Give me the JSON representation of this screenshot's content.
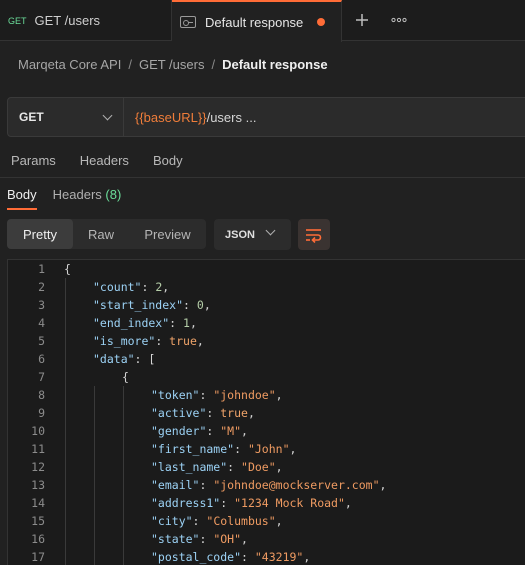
{
  "tabs": [
    {
      "method": "GET",
      "title": "GET /users"
    },
    {
      "title": "Default response"
    }
  ],
  "breadcrumb": {
    "collection": "Marqeta Core API",
    "request": "GET /users",
    "current": "Default response"
  },
  "urlbar": {
    "method": "GET",
    "variable": "{{baseURL}}",
    "path": "/users ..."
  },
  "request_tabs": [
    "Params",
    "Headers",
    "Body"
  ],
  "response_tabs": {
    "body": "Body",
    "headers": "Headers",
    "headers_count": "(8)"
  },
  "view_modes": [
    "Pretty",
    "Raw",
    "Preview"
  ],
  "format": "JSON",
  "code_lines": [
    {
      "n": "1",
      "ind": 0,
      "parts": [
        {
          "t": "{",
          "c": "p"
        }
      ]
    },
    {
      "n": "2",
      "ind": 1,
      "parts": [
        {
          "t": "\"count\"",
          "c": "k"
        },
        {
          "t": ": ",
          "c": "p"
        },
        {
          "t": "2",
          "c": "n"
        },
        {
          "t": ",",
          "c": "p"
        }
      ]
    },
    {
      "n": "3",
      "ind": 1,
      "parts": [
        {
          "t": "\"start_index\"",
          "c": "k"
        },
        {
          "t": ": ",
          "c": "p"
        },
        {
          "t": "0",
          "c": "n"
        },
        {
          "t": ",",
          "c": "p"
        }
      ]
    },
    {
      "n": "4",
      "ind": 1,
      "parts": [
        {
          "t": "\"end_index\"",
          "c": "k"
        },
        {
          "t": ": ",
          "c": "p"
        },
        {
          "t": "1",
          "c": "n"
        },
        {
          "t": ",",
          "c": "p"
        }
      ]
    },
    {
      "n": "5",
      "ind": 1,
      "parts": [
        {
          "t": "\"is_more\"",
          "c": "k"
        },
        {
          "t": ": ",
          "c": "p"
        },
        {
          "t": "true",
          "c": "b"
        },
        {
          "t": ",",
          "c": "p"
        }
      ]
    },
    {
      "n": "6",
      "ind": 1,
      "parts": [
        {
          "t": "\"data\"",
          "c": "k"
        },
        {
          "t": ": [",
          "c": "p"
        }
      ]
    },
    {
      "n": "7",
      "ind": 2,
      "parts": [
        {
          "t": "{",
          "c": "p"
        }
      ]
    },
    {
      "n": "8",
      "ind": 3,
      "parts": [
        {
          "t": "\"token\"",
          "c": "k"
        },
        {
          "t": ": ",
          "c": "p"
        },
        {
          "t": "\"johndoe\"",
          "c": "s"
        },
        {
          "t": ",",
          "c": "p"
        }
      ]
    },
    {
      "n": "9",
      "ind": 3,
      "parts": [
        {
          "t": "\"active\"",
          "c": "k"
        },
        {
          "t": ": ",
          "c": "p"
        },
        {
          "t": "true",
          "c": "b"
        },
        {
          "t": ",",
          "c": "p"
        }
      ]
    },
    {
      "n": "10",
      "ind": 3,
      "parts": [
        {
          "t": "\"gender\"",
          "c": "k"
        },
        {
          "t": ": ",
          "c": "p"
        },
        {
          "t": "\"M\"",
          "c": "s"
        },
        {
          "t": ",",
          "c": "p"
        }
      ]
    },
    {
      "n": "11",
      "ind": 3,
      "parts": [
        {
          "t": "\"first_name\"",
          "c": "k"
        },
        {
          "t": ": ",
          "c": "p"
        },
        {
          "t": "\"John\"",
          "c": "s"
        },
        {
          "t": ",",
          "c": "p"
        }
      ]
    },
    {
      "n": "12",
      "ind": 3,
      "parts": [
        {
          "t": "\"last_name\"",
          "c": "k"
        },
        {
          "t": ": ",
          "c": "p"
        },
        {
          "t": "\"Doe\"",
          "c": "s"
        },
        {
          "t": ",",
          "c": "p"
        }
      ]
    },
    {
      "n": "13",
      "ind": 3,
      "parts": [
        {
          "t": "\"email\"",
          "c": "k"
        },
        {
          "t": ": ",
          "c": "p"
        },
        {
          "t": "\"johndoe@mockserver.com\"",
          "c": "s"
        },
        {
          "t": ",",
          "c": "p"
        }
      ]
    },
    {
      "n": "14",
      "ind": 3,
      "parts": [
        {
          "t": "\"address1\"",
          "c": "k"
        },
        {
          "t": ": ",
          "c": "p"
        },
        {
          "t": "\"1234 Mock Road\"",
          "c": "s"
        },
        {
          "t": ",",
          "c": "p"
        }
      ]
    },
    {
      "n": "15",
      "ind": 3,
      "parts": [
        {
          "t": "\"city\"",
          "c": "k"
        },
        {
          "t": ": ",
          "c": "p"
        },
        {
          "t": "\"Columbus\"",
          "c": "s"
        },
        {
          "t": ",",
          "c": "p"
        }
      ]
    },
    {
      "n": "16",
      "ind": 3,
      "parts": [
        {
          "t": "\"state\"",
          "c": "k"
        },
        {
          "t": ": ",
          "c": "p"
        },
        {
          "t": "\"OH\"",
          "c": "s"
        },
        {
          "t": ",",
          "c": "p"
        }
      ]
    },
    {
      "n": "17",
      "ind": 3,
      "parts": [
        {
          "t": "\"postal_code\"",
          "c": "k"
        },
        {
          "t": ": ",
          "c": "p"
        },
        {
          "t": "\"43219\"",
          "c": "s"
        },
        {
          "t": ",",
          "c": "p"
        }
      ]
    }
  ],
  "colors": {
    "accent": "#ff6c37",
    "method_get": "#6bdd9a",
    "variable": "#ef7d3a",
    "json_key": "#9cd2f5",
    "json_string": "#ef9b62"
  }
}
